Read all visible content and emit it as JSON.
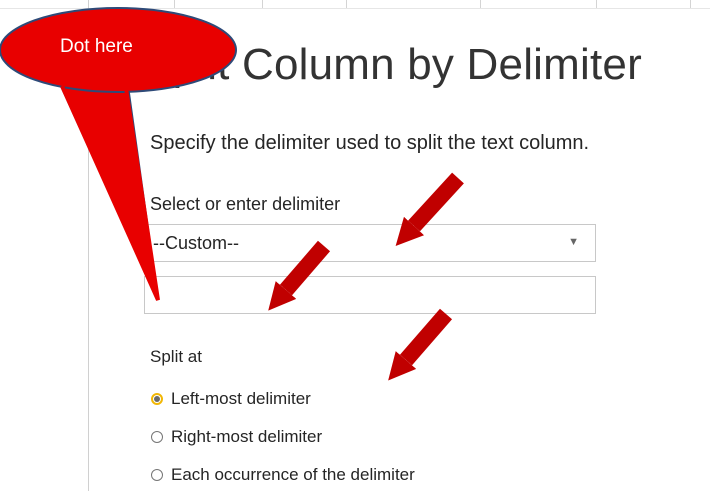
{
  "dialog": {
    "title": "Split Column by Delimiter",
    "description": "Specify the delimiter used to split the text column.",
    "delimiter_label": "Select or enter delimiter",
    "delimiter_selected": "--Custom--",
    "custom_value": ".",
    "split_at": {
      "label": "Split at",
      "options": [
        {
          "label": "Left-most delimiter",
          "checked": true
        },
        {
          "label": "Right-most delimiter",
          "checked": false
        },
        {
          "label": "Each occurrence of the delimiter",
          "checked": false
        }
      ]
    }
  },
  "annotation": {
    "callout_text": "Dot here",
    "callout_color": "#e80000",
    "arrow_color": "#c00000"
  },
  "icons": {
    "dropdown": "chevron-down-icon",
    "radio": "radio-button-icon",
    "arrow": "arrow-down-left-icon"
  }
}
